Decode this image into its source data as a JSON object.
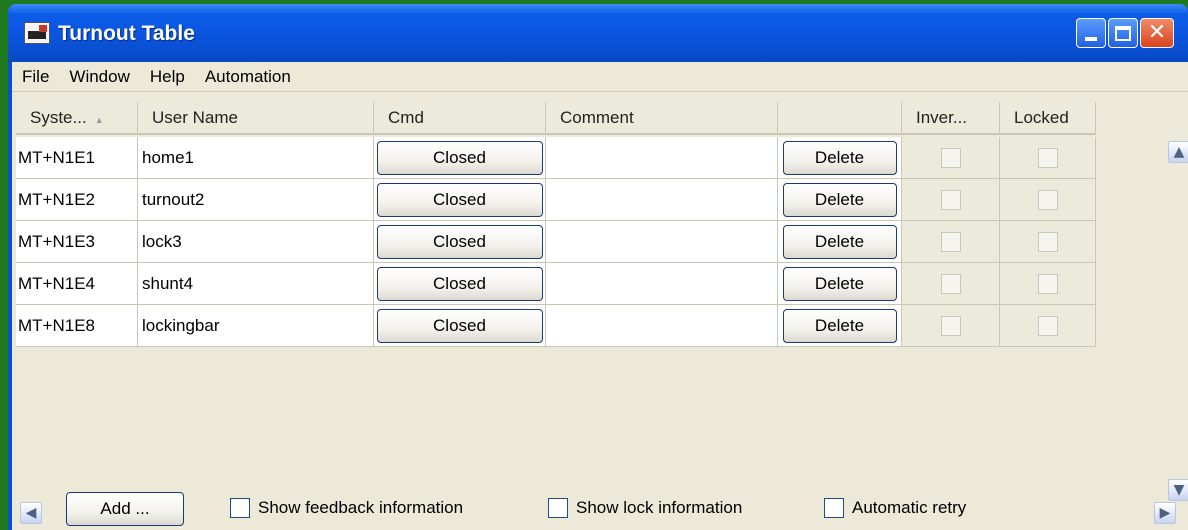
{
  "window": {
    "title": "Turnout Table",
    "controls": {
      "minimize": "minimize-icon",
      "maximize": "maximize-icon",
      "close": "close-icon"
    }
  },
  "menubar": {
    "items": [
      "File",
      "Window",
      "Help",
      "Automation"
    ]
  },
  "table": {
    "headers": {
      "system": "Syste...",
      "user_name": "User Name",
      "cmd": "Cmd",
      "comment": "Comment",
      "delete": "",
      "inverted": "Inver...",
      "locked": "Locked"
    },
    "rows": [
      {
        "system": "MT+N1E1",
        "user_name": "home1",
        "cmd": "Closed",
        "comment": "",
        "delete": "Delete",
        "inverted": false,
        "locked": false
      },
      {
        "system": "MT+N1E2",
        "user_name": "turnout2",
        "cmd": "Closed",
        "comment": "",
        "delete": "Delete",
        "inverted": false,
        "locked": false
      },
      {
        "system": "MT+N1E3",
        "user_name": "lock3",
        "cmd": "Closed",
        "comment": "",
        "delete": "Delete",
        "inverted": false,
        "locked": false
      },
      {
        "system": "MT+N1E4",
        "user_name": "shunt4",
        "cmd": "Closed",
        "comment": "",
        "delete": "Delete",
        "inverted": false,
        "locked": false
      },
      {
        "system": "MT+N1E8",
        "user_name": "lockingbar",
        "cmd": "Closed",
        "comment": "",
        "delete": "Delete",
        "inverted": false,
        "locked": false
      }
    ]
  },
  "bottombar": {
    "add_label": "Add ...",
    "show_feedback": "Show feedback information",
    "show_lock": "Show lock information",
    "automatic_retry": "Automatic retry"
  },
  "colors": {
    "titlebar": "#0a55de",
    "client_bg": "#ece9d8",
    "desktop": "#1f7a1f",
    "close_button": "#d9441d"
  }
}
